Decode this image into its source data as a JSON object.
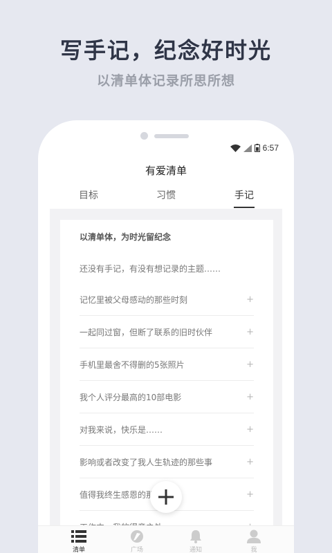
{
  "promo": {
    "headline": "写手记，纪念好时光",
    "subline": "以清单体记录所思所想"
  },
  "status_bar": {
    "time": "6:57",
    "icons": [
      "wifi-icon",
      "signal-icon",
      "battery-icon"
    ]
  },
  "app": {
    "title": "有爱清单"
  },
  "tabs": [
    {
      "label": "目标",
      "active": false
    },
    {
      "label": "习惯",
      "active": false
    },
    {
      "label": "手记",
      "active": true
    }
  ],
  "card": {
    "title": "以清单体，为时光留纪念",
    "intro": "还没有手记，有没有想记录的主题……",
    "plus_symbol": "+",
    "items": [
      "记忆里被父母感动的那些时刻",
      "一起同过窗，但断了联系的旧时伙伴",
      "手机里最舍不得删的5张照片",
      "我个人评分最高的10部电影",
      "对我来说，快乐是……",
      "影响或者改变了我人生轨迹的那些事",
      "值得我终生感恩的那些人",
      "工作中，我的得意之处"
    ]
  },
  "bottom_nav": [
    {
      "label": "清单",
      "icon": "list-icon",
      "active": true
    },
    {
      "label": "广场",
      "icon": "compass-icon",
      "active": false
    },
    {
      "label": "通知",
      "icon": "bell-icon",
      "active": false
    },
    {
      "label": "我",
      "icon": "user-icon",
      "active": false
    }
  ],
  "colors": {
    "background": "#e6e8f0",
    "headline": "#2f3547",
    "subline": "#9a9ea8",
    "active_tab": "#333333"
  }
}
